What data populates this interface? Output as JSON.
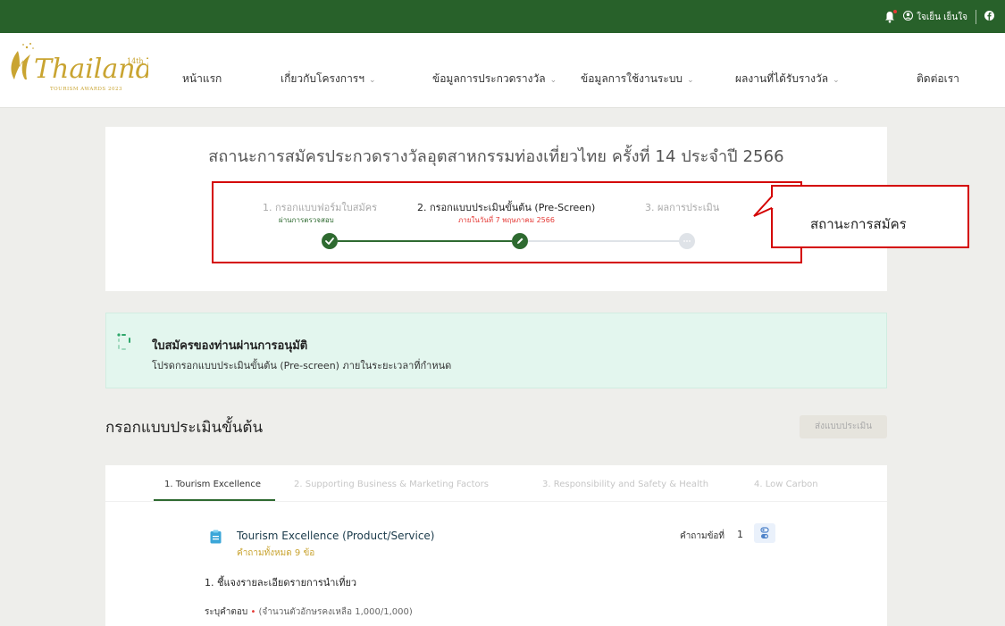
{
  "header": {
    "user_name": "ใจเย็น ​เย็นใจ",
    "colors": {
      "topbar": "#28612a",
      "accent_green": "#2e6a30",
      "annotation_red": "#d40000"
    }
  },
  "logo": {
    "word": "Thailand",
    "sub": "TOURISM AWARDS 2023",
    "edition": "14th"
  },
  "nav": {
    "items": [
      {
        "label": "หน้าแรก",
        "has_dropdown": false
      },
      {
        "label": "เกี่ยวกับโครงการฯ",
        "has_dropdown": true
      },
      {
        "label": "ข้อมูลการประกวดรางวัล",
        "has_dropdown": true
      },
      {
        "label": "ข้อมูลการใช้งานระบบ",
        "has_dropdown": true
      },
      {
        "label": "ผลงานที่ได้รับรางวัล",
        "has_dropdown": true
      },
      {
        "label": "ติดต่อเรา",
        "has_dropdown": false
      }
    ]
  },
  "status": {
    "title": "สถานะการสมัครประกวดรางวัลอุตสาหกรรมท่องเที่ยวไทย ครั้งที่ 14 ประจำปี 2566",
    "steps": [
      {
        "label": "1. กรอกแบบฟอร์มใบสมัคร",
        "sub": "ผ่านการตรวจสอบ",
        "state": "done"
      },
      {
        "label": "2. กรอกแบบประเมินขั้นต้น (Pre-Screen)",
        "sub": "ภายในวันที่ 7 พฤษภาคม 2566",
        "state": "current"
      },
      {
        "label": "3. ผลการประเมิน",
        "sub": "",
        "state": "pending"
      }
    ]
  },
  "annotation": {
    "callout": "สถานะการสมัคร"
  },
  "notice": {
    "title": "ใบสมัครของท่านผ่านการอนุมัติ",
    "desc": "โปรดกรอกแบบประเมินขั้นต้น (Pre-screen) ภายในระยะเวลาที่กำหนด"
  },
  "form": {
    "section_title": "กรอกแบบประเมินขั้นต้น",
    "submit_label": "ส่งแบบประเมิน",
    "tabs": [
      {
        "label": "1. Tourism Excellence",
        "active": true
      },
      {
        "label": "2. Supporting Business & Marketing Factors",
        "active": false
      },
      {
        "label": "3. Responsibility and Safety & Health",
        "active": false
      },
      {
        "label": "4. Low Carbon",
        "active": false
      }
    ],
    "question_group": {
      "title": "Tourism Excellence (Product/Service)",
      "count_text": "คำถามทั้งหมด 9 ข้อ",
      "question_no_label": "คำถามข้อที่",
      "question_no": "1"
    },
    "question": {
      "text": "1. ชี้แจงรายละเอียดรายการนำเที่ยว",
      "answer_label": "ระบุคำตอบ",
      "required_mark": "•",
      "char_hint": "(จำนวนตัวอักษรคงเหลือ 1,000/1,000)"
    }
  }
}
